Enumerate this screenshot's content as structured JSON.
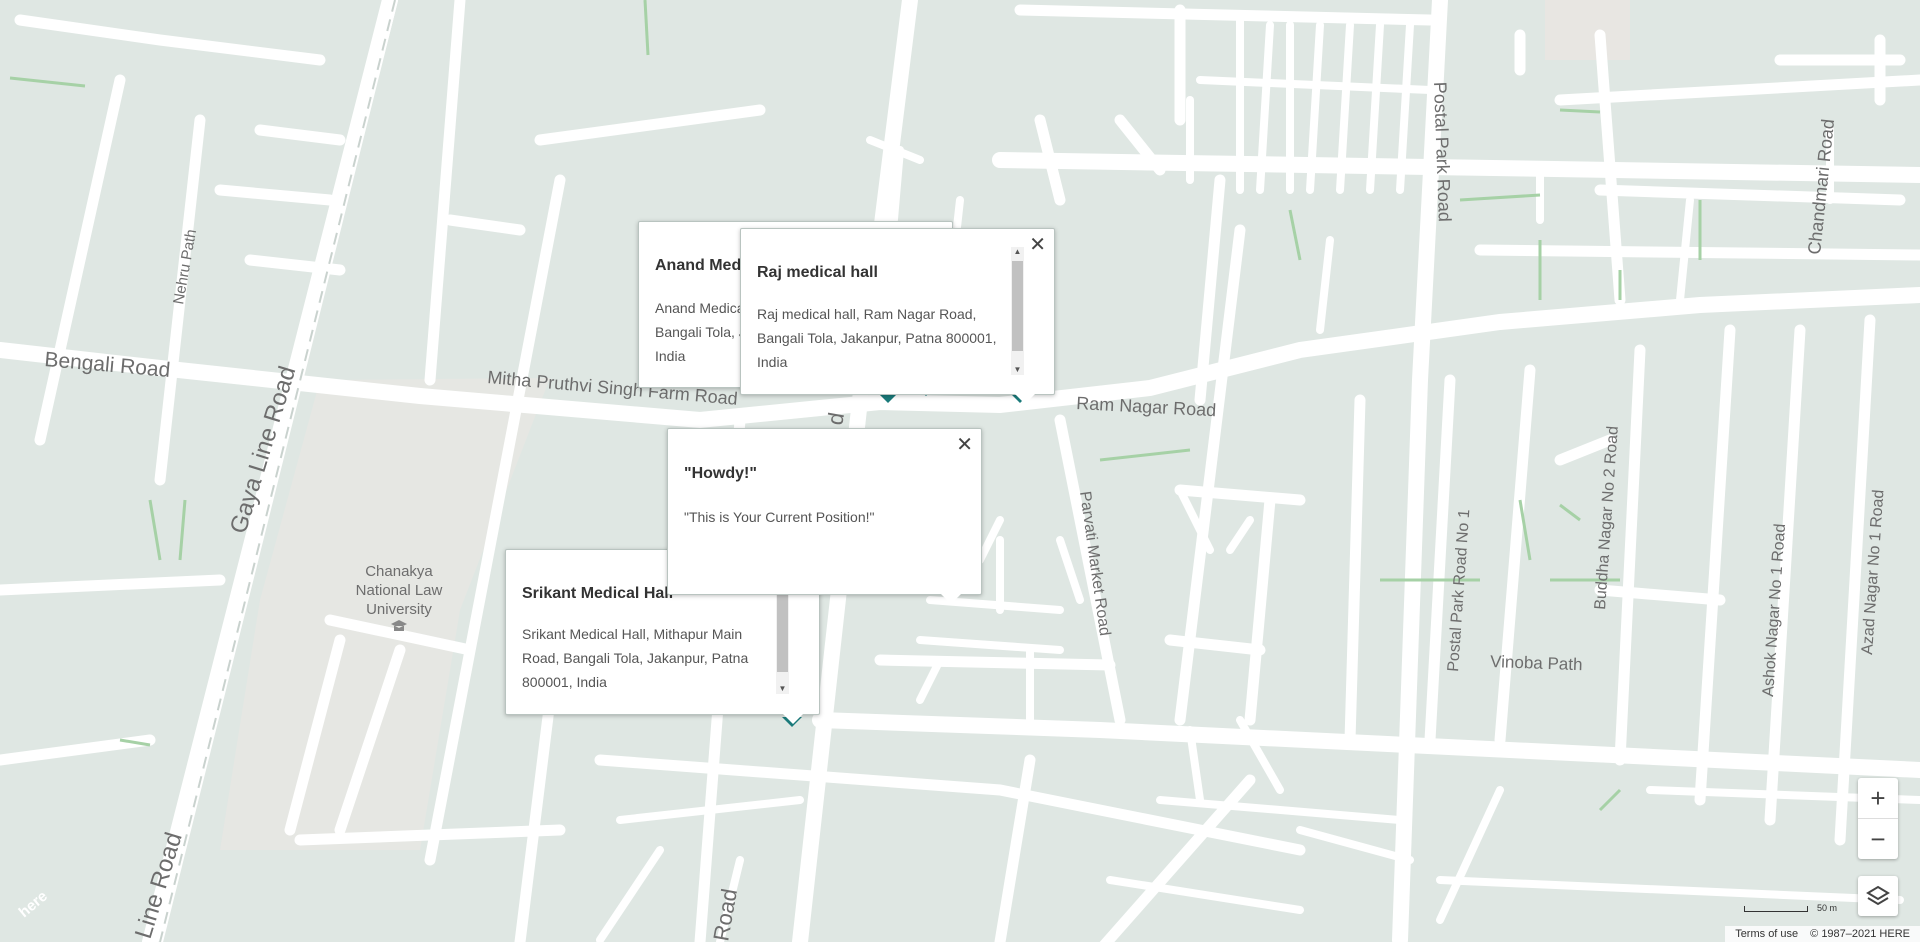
{
  "map": {
    "road_labels": {
      "bengali_road": "Bengali Road",
      "gaya_line_road": "Gaya Line Road",
      "line_road": "Line Road",
      "nehru_path": "Nehru Path",
      "mitha_pruthvi": "Mitha Pruthvi Singh Farm Road",
      "ram_nagar": "Ram Nagar Road",
      "parvati_market": "Parvati Market Road",
      "postal_park": "Postal Park Road",
      "postal_park_1": "Postal Park Road No 1",
      "buddha_nagar": "Buddha Nagar No 2 Road",
      "ashok_nagar": "Ashok Nagar No 1 Road",
      "azad_nagar": "Azad Nagar No 1 Road",
      "chandmari": "Chandmari Road",
      "vinoba_path": "Vinoba Path",
      "road_partial": "Road",
      "road_partial_top": "d"
    },
    "poi": {
      "line1": "Chanakya",
      "line2": "National Law",
      "line3": "University"
    },
    "logo": "here"
  },
  "bubbles": {
    "anand": {
      "title": "Anand Med",
      "address_lines": [
        "Anand Medica",
        "Bangali Tola, J",
        "India"
      ]
    },
    "raj": {
      "title": "Raj medical hall",
      "address_lines": [
        "Raj medical hall, Ram Nagar Road,",
        "Bangali Tola, Jakanpur, Patna 800001,",
        "India"
      ]
    },
    "howdy": {
      "title": "\"Howdy!\"",
      "text": "\"This is Your Current Position!\""
    },
    "srikant": {
      "title": "Srikant Medical Hall",
      "address_lines": [
        "Srikant Medical Hall, Mithapur Main",
        "Road, Bangali Tola, Jakanpur, Patna",
        "800001, India"
      ]
    }
  },
  "controls": {
    "zoom_in": "+",
    "zoom_out": "−",
    "layers_icon": "layers-icon"
  },
  "footer": {
    "scale": "50 m",
    "terms": "Terms of use",
    "copyright": "© 1987–2021 HERE"
  }
}
